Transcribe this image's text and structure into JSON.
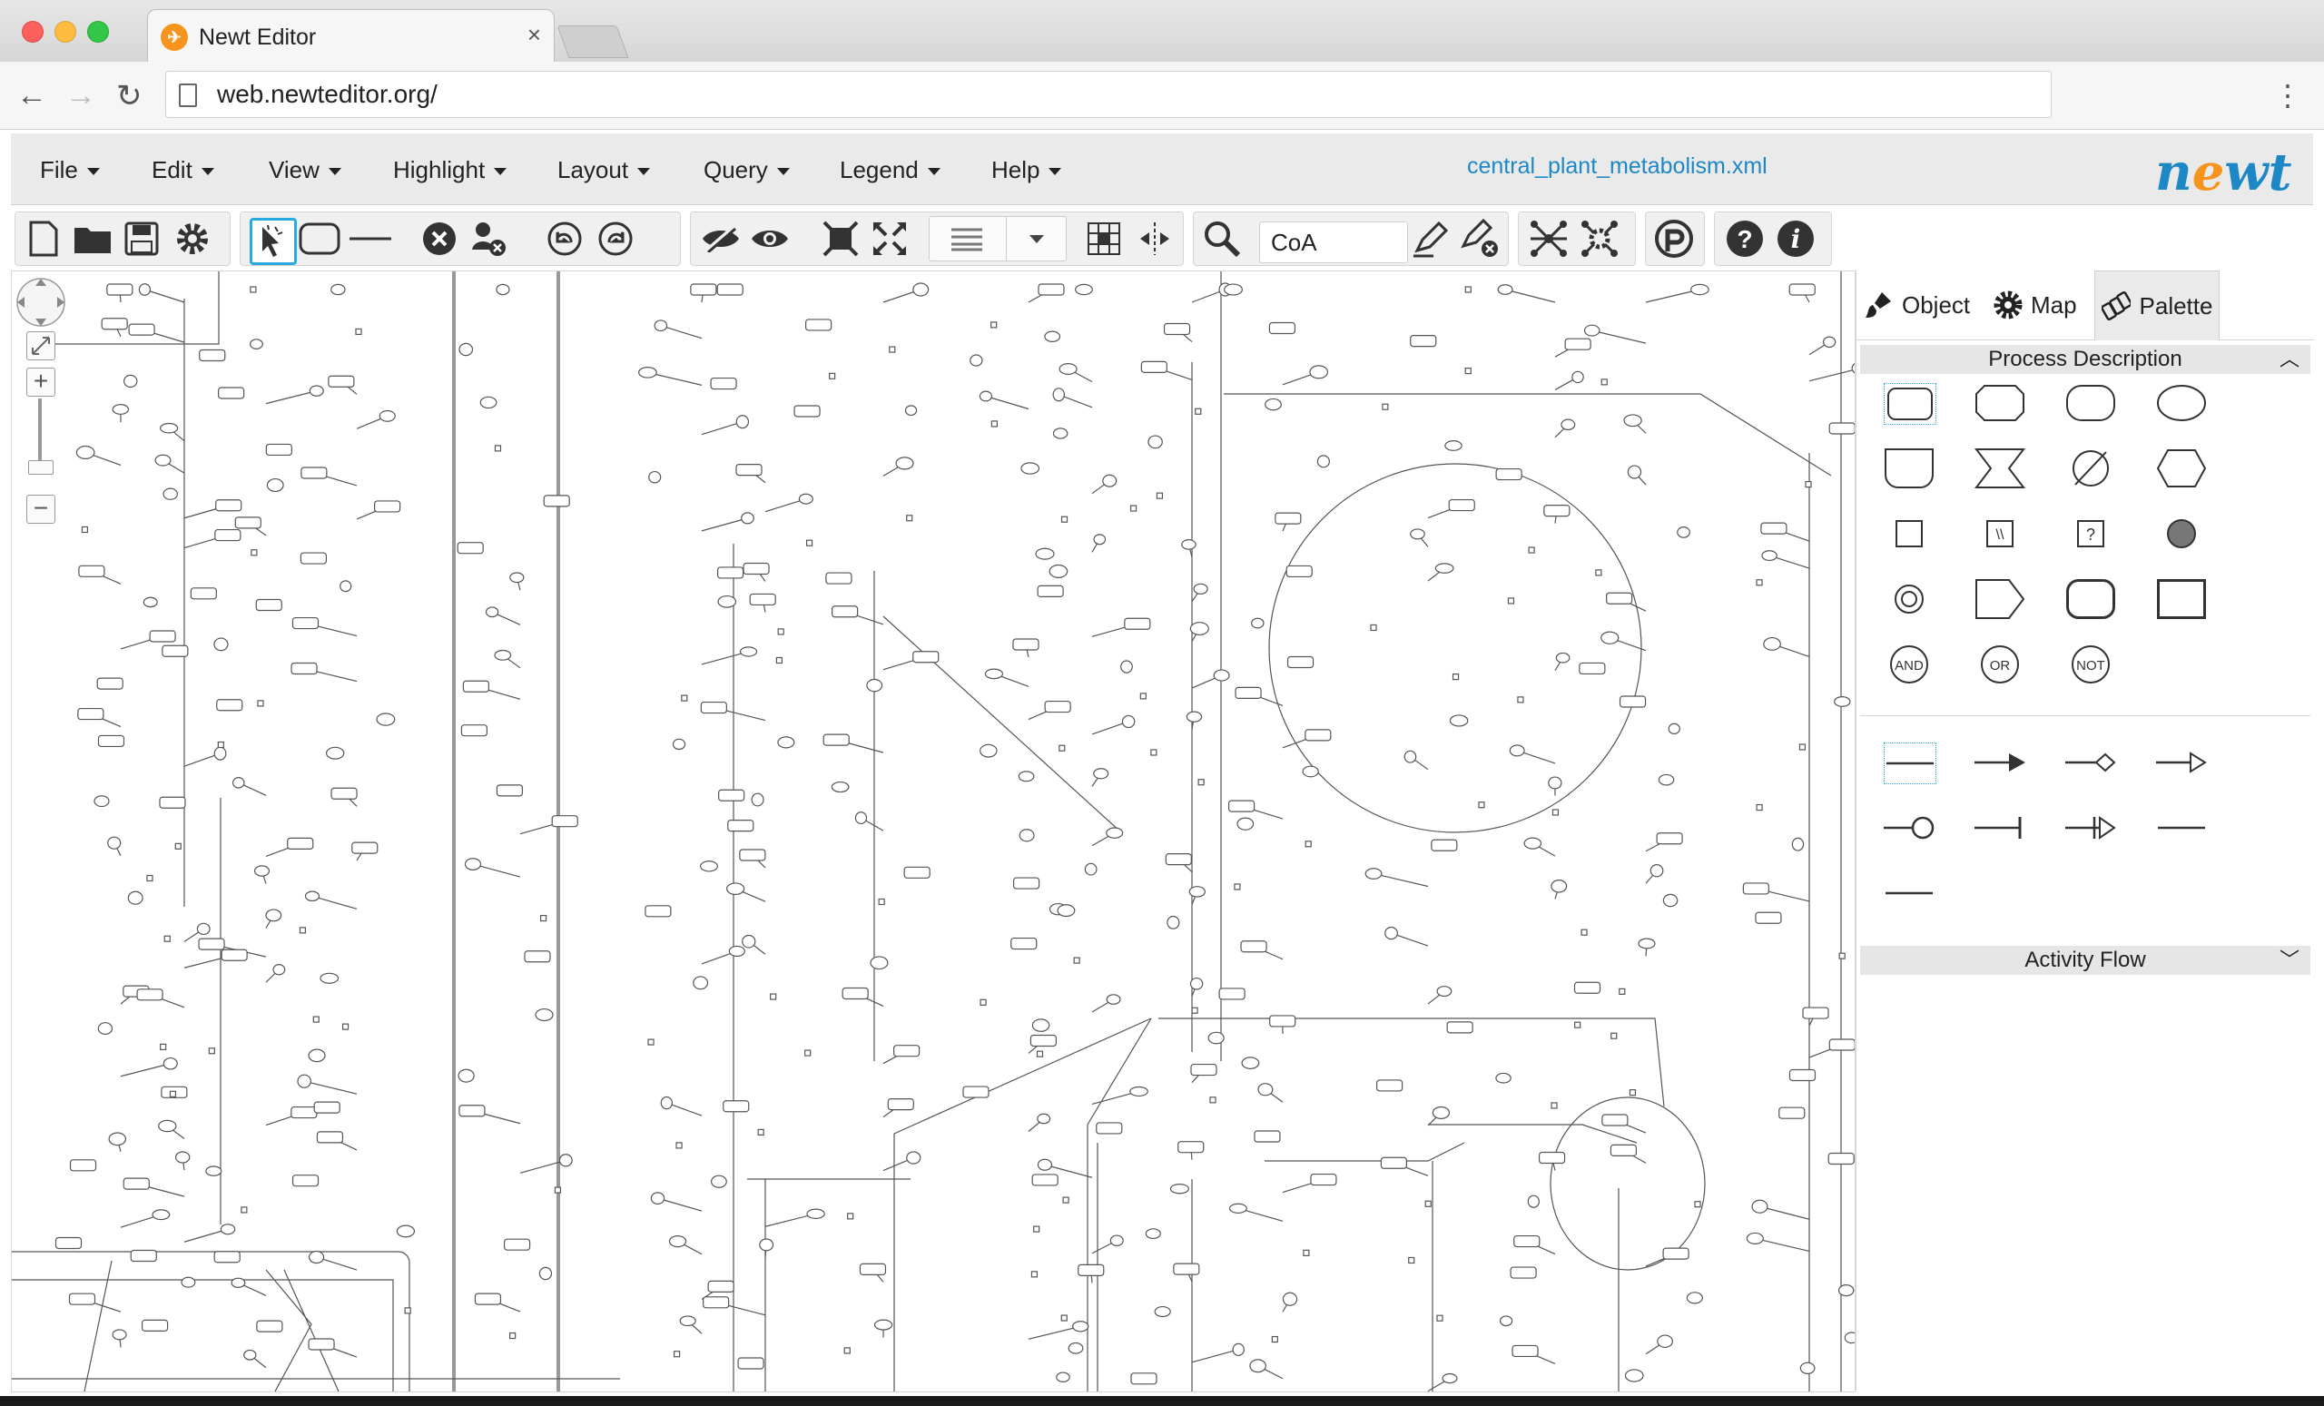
{
  "browser": {
    "tab_title": "Newt Editor",
    "tab_close": "×",
    "url": "web.newteditor.org/",
    "back_label": "←",
    "forward_label": "→",
    "reload_label": "↻",
    "menu_label": "⋮"
  },
  "menubar": {
    "items": [
      {
        "label": "File"
      },
      {
        "label": "Edit"
      },
      {
        "label": "View"
      },
      {
        "label": "Highlight"
      },
      {
        "label": "Layout"
      },
      {
        "label": "Query"
      },
      {
        "label": "Legend"
      },
      {
        "label": "Help"
      }
    ],
    "filename": "central_plant_metabolism.xml",
    "logo_prefix": "n",
    "logo_o": "e",
    "logo_suffix": "wt"
  },
  "toolbar": {
    "search_value": "CoA",
    "icons": [
      "new-file-icon",
      "open-folder-icon",
      "save-icon",
      "settings-gear-icon",
      "select-pointer-icon",
      "add-node-icon",
      "add-edge-icon",
      "delete-icon",
      "delete-element-icon",
      "undo-icon",
      "redo-icon",
      "hide-icon",
      "show-icon",
      "collapse-icon",
      "expand-icon",
      "align-icon",
      "grid-icon",
      "guidelines-icon",
      "search-icon",
      "highlight-icon",
      "remove-highlight-icon",
      "layout-icon",
      "layout-settings-icon",
      "pathway-icon",
      "help-icon",
      "about-icon"
    ]
  },
  "panel": {
    "tabs": [
      {
        "label": "Object"
      },
      {
        "label": "Map"
      },
      {
        "label": "Palette"
      }
    ],
    "process_description_title": "Process Description",
    "activity_flow_title": "Activity Flow",
    "logic_and": "AND",
    "logic_or": "OR",
    "logic_not": "NOT",
    "unknown_q": "?",
    "omitted_slashes": "\\\\"
  },
  "zoom_controls": {
    "zoom_in": "+",
    "zoom_out": "−"
  },
  "colors": {
    "accent": "#27a9e1",
    "link_blue": "#1e88c7",
    "logo_orange": "#f7941d"
  }
}
